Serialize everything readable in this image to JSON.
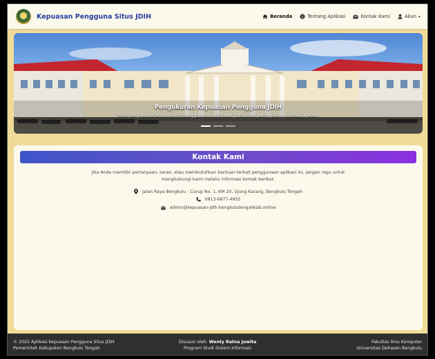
{
  "navbar": {
    "brand": "Kepuasan Pengguna Situs JDIH",
    "items": [
      {
        "label": "Beranda",
        "icon": "home-icon"
      },
      {
        "label": "Tentang Aplikasi",
        "icon": "info-icon"
      },
      {
        "label": "Kontak Kami",
        "icon": "envelope-icon"
      },
      {
        "label": "Akun",
        "icon": "user-icon"
      }
    ]
  },
  "hero": {
    "title": "Pengukuran Kepuasan Pengguna JDIH",
    "subtitle": "Nilai pengalaman Anda dalam menggunakan situs web JDIH untuk peningkatan kualitas layanan"
  },
  "contact": {
    "heading": "Kontak Kami",
    "intro": "Jika Anda memiliki pertanyaan, saran, atau membutuhkan bantuan terkait penggunaan aplikasi ini, jangan ragu untuk menghubungi kami melalui informasi kontak berikut:",
    "address": "Jalan Raya Bengkulu - Curup No. 1, KM 20, Ujung Karang, Bengkulu Tengah",
    "phone": "0813-6877-4955",
    "email": "admin@kepuasan-jdih-bengkulutengahkab.online"
  },
  "footer": {
    "left_line1": "© 2025 Aplikasi Kepuasan Pengguna Situs JDIH",
    "left_line2": "Pemerintah Kabupaten Bengkulu Tengah",
    "mid_prefix": "Disusun oleh:",
    "mid_author": "Wenty Ratna Juwita",
    "mid_line2": "Program Studi Sistem Informasi",
    "right_line1": "Fakultas Ilmu Komputer",
    "right_line2": "Universitas Dehasen Bengkulu"
  }
}
